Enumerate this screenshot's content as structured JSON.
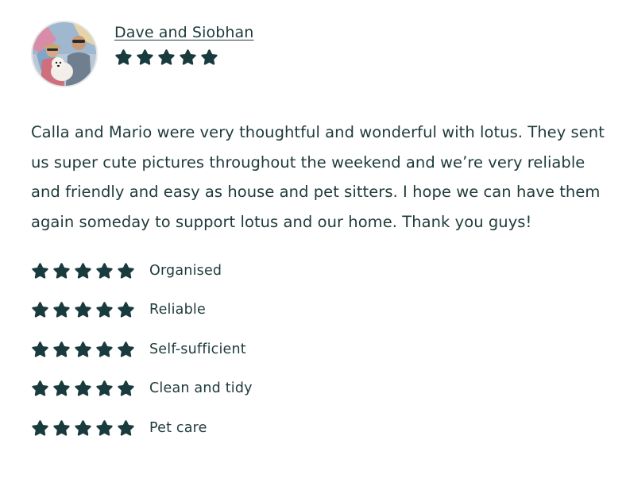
{
  "review": {
    "author": "Dave and Siobhan",
    "overall_rating": 5,
    "text": "Calla and Mario were very thoughtful and wonderful with lotus. They sent us super cute pictures throughout the weekend and we’re very reliable and friendly and easy as house and pet sitters. I hope we can have them again someday to support lotus and our home. Thank you guys!￼",
    "categories": [
      {
        "label": "Organised",
        "rating": 5
      },
      {
        "label": "Reliable",
        "rating": 5
      },
      {
        "label": "Self-sufficient",
        "rating": 5
      },
      {
        "label": "Clean and tidy",
        "rating": 5
      },
      {
        "label": "Pet care",
        "rating": 5
      }
    ]
  },
  "colors": {
    "text": "#1f3a3a",
    "star": "#1a3b3e"
  },
  "icons": {
    "star": "star-icon"
  }
}
